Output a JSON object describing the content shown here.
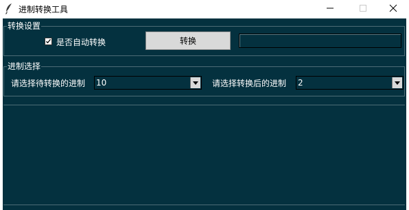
{
  "window": {
    "title": "进制转换工具",
    "icon": "feather-icon"
  },
  "conversion_settings": {
    "group_label": "转换设置",
    "auto_convert_label": "是否自动转换",
    "auto_convert_checked": true,
    "convert_button_label": "转换",
    "result_value": ""
  },
  "base_selection": {
    "group_label": "进制选择",
    "source_label": "请选择待转换的进制",
    "source_value": "10",
    "target_label": "请选择转换后的进制",
    "target_value": "2"
  },
  "colors": {
    "background": "#04313f",
    "text": "#ffffff",
    "button": "#d9d9d9"
  }
}
